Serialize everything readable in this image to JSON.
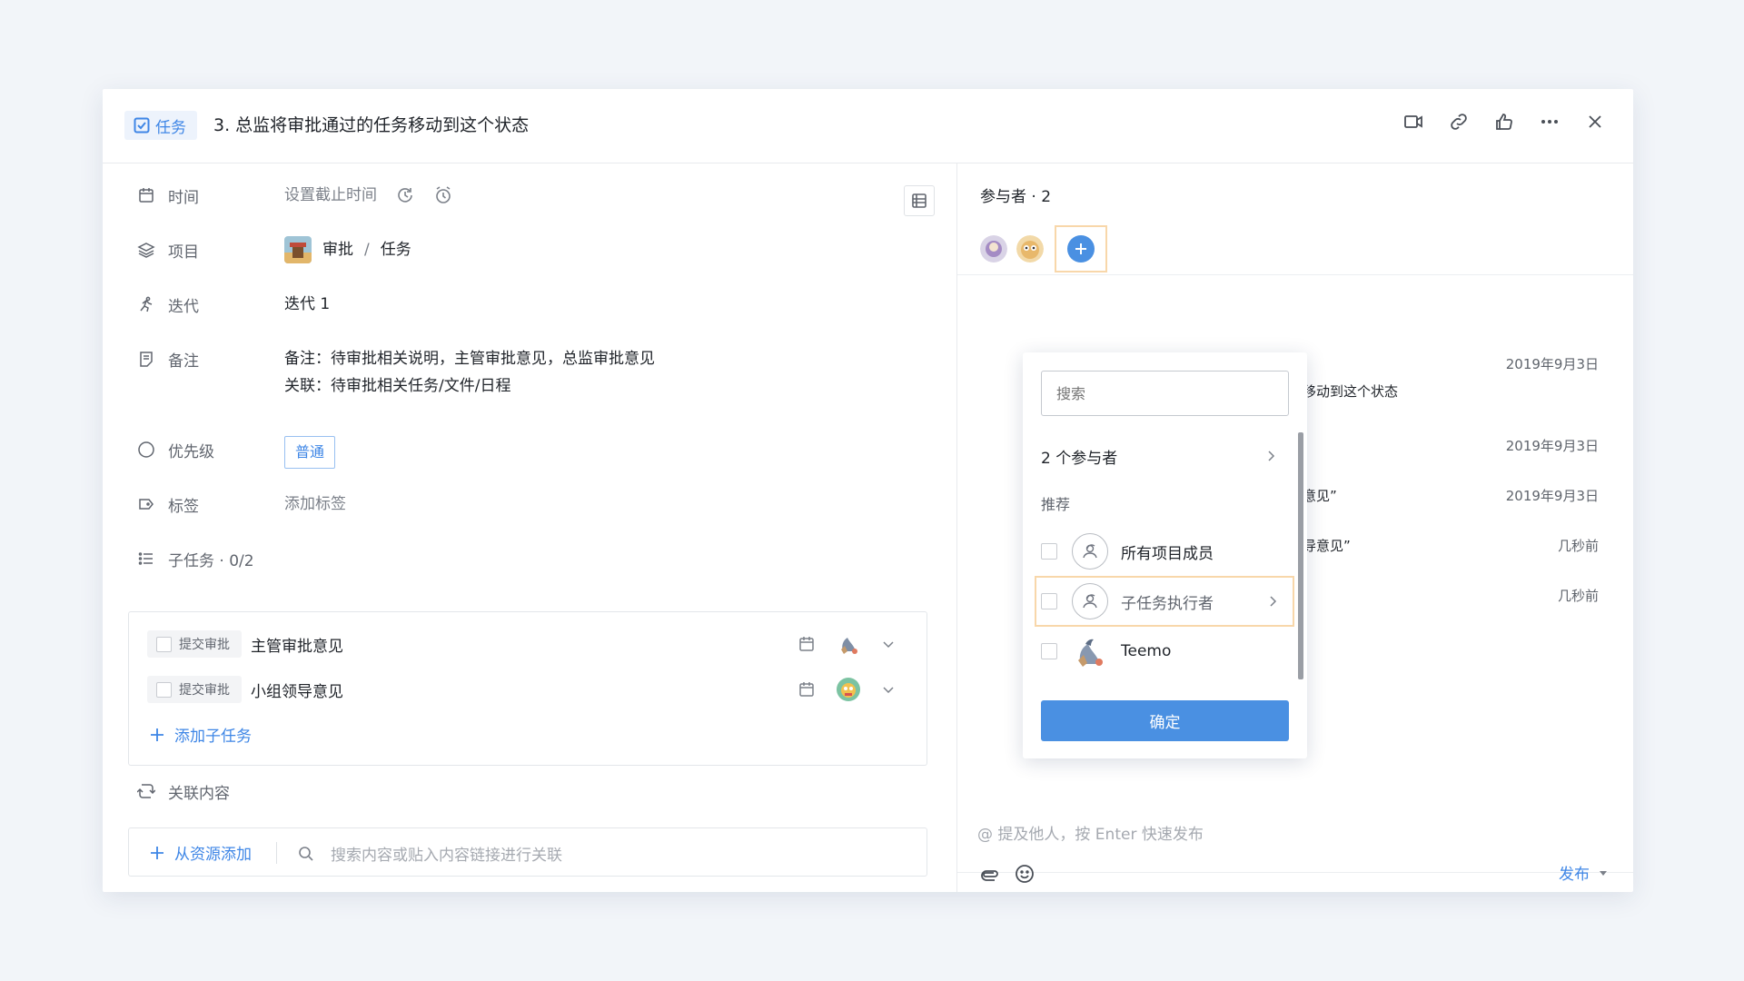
{
  "header": {
    "type_label": "任务",
    "title": "3. 总监将审批通过的任务移动到这个状态"
  },
  "fields": {
    "time_label": "时间",
    "time_value": "设置截止时间",
    "project_label": "项目",
    "project_name": "审批",
    "project_sep": "/",
    "project_list": "任务",
    "iteration_label": "迭代",
    "iteration_value": "迭代 1",
    "note_label": "备注",
    "note_line1": "备注：待审批相关说明，主管审批意见，总监审批意见",
    "note_line2": "关联：待审批相关任务/文件/日程",
    "priority_label": "优先级",
    "priority_value": "普通",
    "tag_label": "标签",
    "tag_value": "添加标签",
    "subtask_label": "子任务 · 0/2"
  },
  "subtasks": [
    {
      "status": "提交审批",
      "name": "主管审批意见"
    },
    {
      "status": "提交审批",
      "name": "小组领导意见"
    }
  ],
  "add_subtask": "添加子任务",
  "related_label": "关联内容",
  "resource": {
    "add_label": "从资源添加",
    "search_placeholder": "搜索内容或贴入内容链接进行关联"
  },
  "participants": {
    "title": "参与者 · 2"
  },
  "activity": [
    {
      "date": "2019年9月3日",
      "text": ""
    },
    {
      "date": "",
      "text": "移动到这个状态"
    },
    {
      "date": "2019年9月3日",
      "text": ""
    },
    {
      "date": "2019年9月3日",
      "text": "意见”"
    },
    {
      "date": "几秒前",
      "text": "导意见”"
    },
    {
      "date": "几秒前",
      "text": ""
    }
  ],
  "comment": {
    "placeholder": "@ 提及他人，按 Enter 快速发布",
    "publish": "发布"
  },
  "popover": {
    "search_placeholder": "搜索",
    "count_label": "2 个参与者",
    "recommend_label": "推荐",
    "options": [
      {
        "name": "所有项目成员"
      },
      {
        "name": "子任务执行者"
      },
      {
        "name": "Teemo"
      }
    ],
    "confirm": "确定"
  },
  "colors": {
    "accent": "#4a90e2",
    "link": "#3e86e6",
    "highlight": "#f8d7aa"
  }
}
